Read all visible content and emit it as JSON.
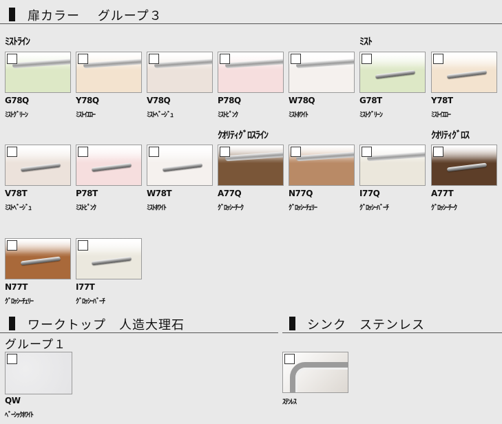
{
  "sections": {
    "door": {
      "title": "扉カラー　 グループ３"
    },
    "worktop": {
      "title": "ワークトップ　人造大理石",
      "group": "グループ１"
    },
    "sink": {
      "title": "シンク　ステンレス"
    }
  },
  "subheadings": {
    "mist_line": "ﾐｽﾄﾗｲﾝ",
    "mist": "ﾐｽﾄ",
    "glossy_line": "ｸｵﾘﾃｨｸﾞﾛｽﾗｲﾝ",
    "glossy": "ｸｵﾘﾃｨｸﾞﾛｽ"
  },
  "swatches": [
    {
      "code": "G78Q",
      "name": "ﾐｽﾄｸﾞﾘｰﾝ",
      "color": "#dde8c6"
    },
    {
      "code": "Y78Q",
      "name": "ﾐｽﾄｲｴﾛｰ",
      "color": "#f3e3cf"
    },
    {
      "code": "V78Q",
      "name": "ﾐｽﾄﾍﾞｰｼﾞｭ",
      "color": "#ece2db"
    },
    {
      "code": "P78Q",
      "name": "ﾐｽﾄﾋﾟﾝｸ",
      "color": "#f6dede"
    },
    {
      "code": "W78Q",
      "name": "ﾐｽﾄﾎﾜｲﾄ",
      "color": "#f5f1ee"
    },
    {
      "code": "G78T",
      "name": "ﾐｽﾄｸﾞﾘｰﾝ",
      "color": "#dde8c6"
    },
    {
      "code": "Y78T",
      "name": "ﾐｽﾄｲｴﾛｰ",
      "color": "#f3e3cf"
    },
    {
      "code": "V78T",
      "name": "ﾐｽﾄﾍﾞｰｼﾞｭ",
      "color": "#ece2db"
    },
    {
      "code": "P78T",
      "name": "ﾐｽﾄﾋﾟﾝｸ",
      "color": "#f6dede"
    },
    {
      "code": "W78T",
      "name": "ﾐｽﾄﾎﾜｲﾄ",
      "color": "#f5f1ee"
    },
    {
      "code": "A77Q",
      "name": "ｸﾞﾛｯｼｰﾁｰｸ",
      "color": "#7a5638"
    },
    {
      "code": "N77Q",
      "name": "ｸﾞﾛｯｼｰﾁｪﾘｰ",
      "color": "#b98a66"
    },
    {
      "code": "I77Q",
      "name": "ｸﾞﾛｯｼｰﾊﾞｰﾁ",
      "color": "#ebe7dc"
    },
    {
      "code": "A77T",
      "name": "ｸﾞﾛｯｼｰﾁｰｸ",
      "color": "#5d3e28"
    },
    {
      "code": "N77T",
      "name": "ｸﾞﾛｯｼｰﾁｪﾘｰ",
      "color": "#a9693a"
    },
    {
      "code": "I77T",
      "name": "ｸﾞﾛｯｼｰﾊﾞｰﾁ",
      "color": "#ebe8de"
    }
  ],
  "worktop": {
    "code": "QW",
    "name": "ﾍﾞｰｼｯｸﾎﾜｲﾄ",
    "color": "#e4e4e6"
  },
  "sink": {
    "name": "ｽﾃﾝﾚｽ",
    "color": "#ddd8d2"
  }
}
